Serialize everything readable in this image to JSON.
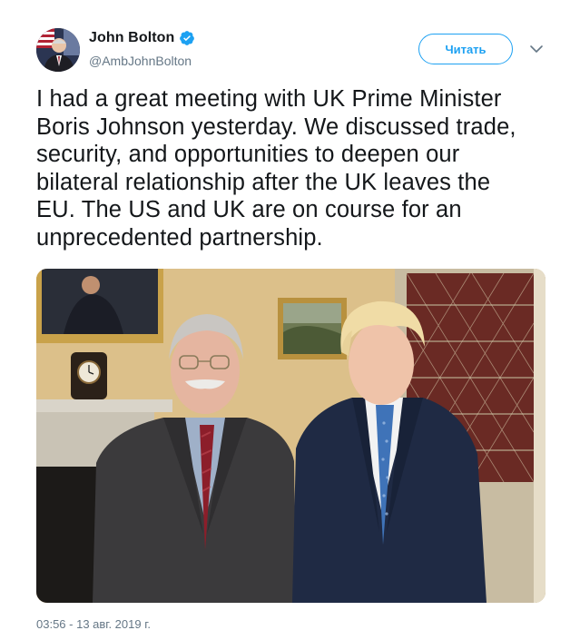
{
  "author": {
    "display_name": "John Bolton",
    "handle": "@AmbJohnBolton",
    "verified": true,
    "avatar_icon": "profile-photo"
  },
  "actions": {
    "follow_label": "Читать",
    "more_icon": "chevron-down-icon"
  },
  "tweet": {
    "text": "I had a great meeting with UK Prime Minister\nBoris Johnson yesterday. We discussed trade,\nsecurity, and opportunities to deepen our\nbilateral relationship after the UK leaves the\nEU. The US and UK are on course for an\nunprecedented partnership.",
    "timestamp": "03:56 - 13 авг. 2019 г."
  },
  "colors": {
    "accent": "#1da1f2",
    "text": "#14171a",
    "muted": "#657786"
  }
}
